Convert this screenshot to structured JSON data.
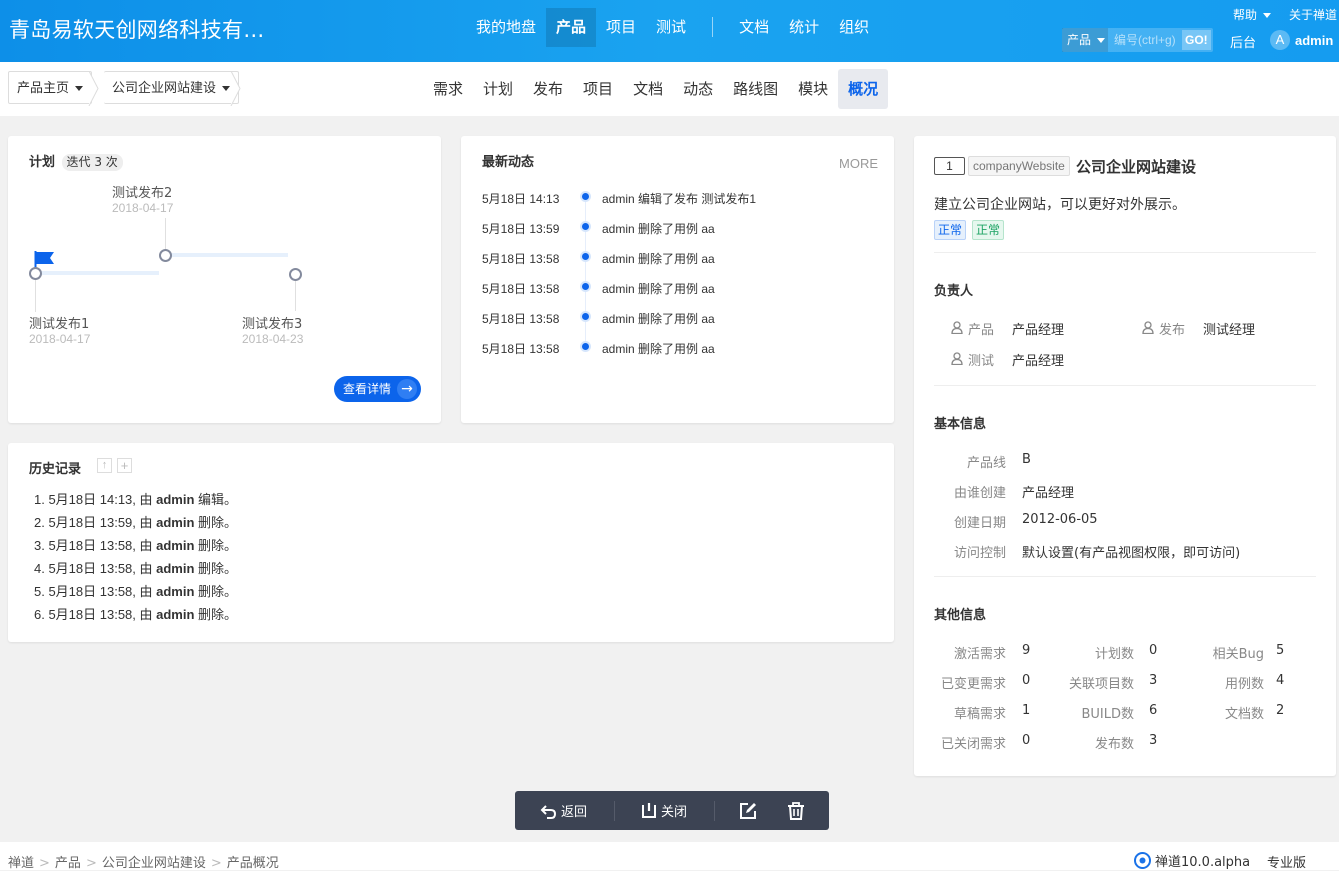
{
  "header": {
    "company": "青岛易软天创网络科技有…",
    "nav": [
      "我的地盘",
      "产品",
      "项目",
      "测试"
    ],
    "nav2": [
      "文档",
      "统计",
      "组织"
    ],
    "help": "帮助",
    "about": "关于禅道",
    "search_type": "产品",
    "search_placeholder": "编号(ctrl+g)",
    "go": "GO!",
    "backend": "后台",
    "avatar_letter": "A",
    "user": "admin"
  },
  "subbar": {
    "crumb1": "产品主页",
    "crumb2": "公司企业网站建设",
    "tabs": [
      "需求",
      "计划",
      "发布",
      "项目",
      "文档",
      "动态",
      "路线图",
      "模块",
      "概况"
    ]
  },
  "plan": {
    "title": "计划",
    "badge": "迭代 3 次",
    "items": [
      {
        "name": "测试发布2",
        "date": "2018-04-17"
      },
      {
        "name": "测试发布1",
        "date": "2018-04-17"
      },
      {
        "name": "测试发布3",
        "date": "2018-04-23"
      }
    ],
    "detail_btn": "查看详情",
    "arrow": "→"
  },
  "dynamics": {
    "title": "最新动态",
    "more": "MORE",
    "items": [
      {
        "time": "5月18日 14:13",
        "text": "admin 编辑了发布 测试发布1"
      },
      {
        "time": "5月18日 13:59",
        "text": "admin 删除了用例 aa"
      },
      {
        "time": "5月18日 13:58",
        "text": "admin 删除了用例 aa"
      },
      {
        "time": "5月18日 13:58",
        "text": "admin 删除了用例 aa"
      },
      {
        "time": "5月18日 13:58",
        "text": "admin 删除了用例 aa"
      },
      {
        "time": "5月18日 13:58",
        "text": "admin 删除了用例 aa"
      }
    ]
  },
  "history": {
    "title": "历史记录",
    "items": [
      {
        "pre": "1. 5月18日 14:13, 由 ",
        "who": "admin",
        "act": " 编辑。"
      },
      {
        "pre": "2. 5月18日 13:59, 由 ",
        "who": "admin",
        "act": " 删除。"
      },
      {
        "pre": "3. 5月18日 13:58, 由 ",
        "who": "admin",
        "act": " 删除。"
      },
      {
        "pre": "4. 5月18日 13:58, 由 ",
        "who": "admin",
        "act": " 删除。"
      },
      {
        "pre": "5. 5月18日 13:58, 由 ",
        "who": "admin",
        "act": " 删除。"
      },
      {
        "pre": "6. 5月18日 13:58, 由 ",
        "who": "admin",
        "act": " 删除。"
      }
    ]
  },
  "product": {
    "id": "1",
    "code": "companyWebsite",
    "name": "公司企业网站建设",
    "desc": "建立公司企业网站，可以更好对外展示。",
    "tag1": "正常",
    "tag2": "正常"
  },
  "owners": {
    "title": "负责人",
    "items": [
      {
        "label": "产品",
        "value": "产品经理"
      },
      {
        "label": "发布",
        "value": "测试经理"
      },
      {
        "label": "测试",
        "value": "产品经理"
      }
    ]
  },
  "basic": {
    "title": "基本信息",
    "rows": [
      {
        "label": "产品线",
        "value": "B"
      },
      {
        "label": "由谁创建",
        "value": "产品经理"
      },
      {
        "label": "创建日期",
        "value": "2012-06-05"
      },
      {
        "label": "访问控制",
        "value": "默认设置(有产品视图权限，即可访问)"
      }
    ]
  },
  "other": {
    "title": "其他信息",
    "cols": [
      [
        {
          "label": "激活需求",
          "value": "9"
        },
        {
          "label": "已变更需求",
          "value": "0"
        },
        {
          "label": "草稿需求",
          "value": "1"
        },
        {
          "label": "已关闭需求",
          "value": "0"
        }
      ],
      [
        {
          "label": "计划数",
          "value": "0"
        },
        {
          "label": "关联项目数",
          "value": "3"
        },
        {
          "label": "BUILD数",
          "value": "6"
        },
        {
          "label": "发布数",
          "value": "3"
        }
      ],
      [
        {
          "label": "相关Bug",
          "value": "5"
        },
        {
          "label": "用例数",
          "value": "4"
        },
        {
          "label": "文档数",
          "value": "2"
        }
      ]
    ]
  },
  "actions": {
    "back": "返回",
    "close": "关闭"
  },
  "footer": {
    "crumbs": [
      "禅道",
      "产品",
      "公司企业网站建设",
      "产品概况"
    ],
    "version": "禅道10.0.alpha",
    "edition": "专业版"
  }
}
